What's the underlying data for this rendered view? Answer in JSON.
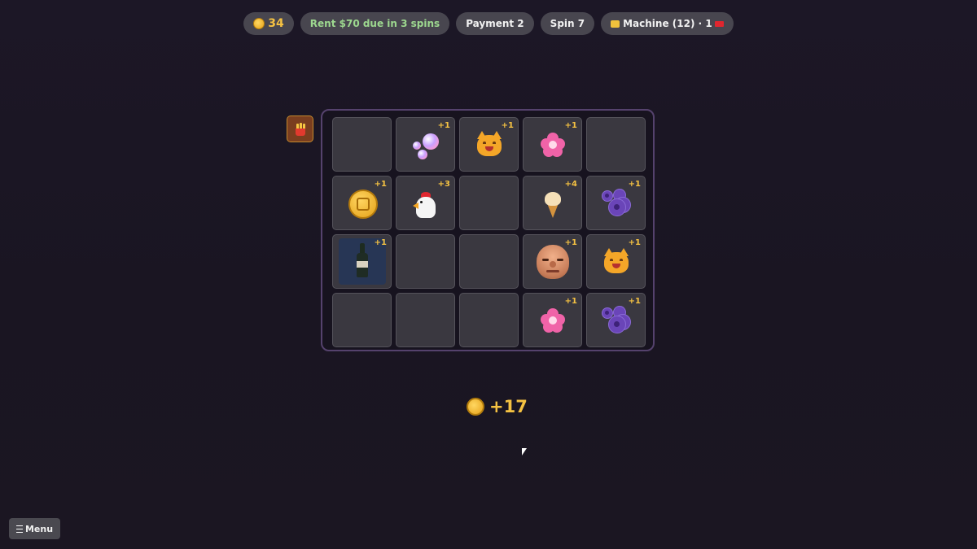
{
  "topbar": {
    "coins": "34",
    "rent": "Rent $70 due in 3 spins",
    "payment": "Payment 2",
    "spin": "Spin 7",
    "machine": "Machine (12) · 1"
  },
  "items": [
    {
      "icon": "fries-icon"
    }
  ],
  "board": {
    "rows": [
      [
        {
          "symbol": "empty",
          "bonus": ""
        },
        {
          "symbol": "bubbles",
          "bonus": "+1"
        },
        {
          "symbol": "cat",
          "bonus": "+1"
        },
        {
          "symbol": "flower",
          "bonus": "+1"
        },
        {
          "symbol": "empty",
          "bonus": ""
        }
      ],
      [
        {
          "symbol": "coin",
          "bonus": "+1"
        },
        {
          "symbol": "chicken",
          "bonus": "+3"
        },
        {
          "symbol": "empty",
          "bonus": ""
        },
        {
          "symbol": "ice-cream",
          "bonus": "+4"
        },
        {
          "symbol": "grapes",
          "bonus": "+1"
        }
      ],
      [
        {
          "symbol": "wine-bottle",
          "bonus": "+1"
        },
        {
          "symbol": "empty",
          "bonus": ""
        },
        {
          "symbol": "empty",
          "bonus": ""
        },
        {
          "symbol": "bald-face",
          "bonus": "+1"
        },
        {
          "symbol": "cat",
          "bonus": "+1"
        }
      ],
      [
        {
          "symbol": "empty",
          "bonus": ""
        },
        {
          "symbol": "empty",
          "bonus": ""
        },
        {
          "symbol": "empty",
          "bonus": ""
        },
        {
          "symbol": "flower",
          "bonus": "+1"
        },
        {
          "symbol": "grapes",
          "bonus": "+1"
        }
      ]
    ]
  },
  "payout": "+17",
  "menu": {
    "label": "Menu"
  },
  "colors": {
    "gold": "#f5c242",
    "rent_green": "#9dd88f",
    "board_border": "#55426d"
  }
}
